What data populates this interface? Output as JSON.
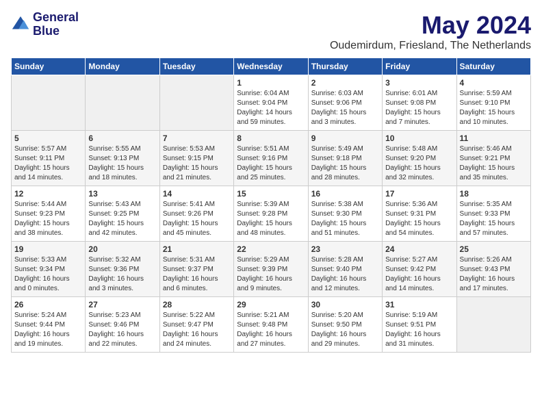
{
  "header": {
    "logo_line1": "General",
    "logo_line2": "Blue",
    "month_title": "May 2024",
    "subtitle": "Oudemirdum, Friesland, The Netherlands"
  },
  "weekdays": [
    "Sunday",
    "Monday",
    "Tuesday",
    "Wednesday",
    "Thursday",
    "Friday",
    "Saturday"
  ],
  "weeks": [
    [
      {
        "day": "",
        "content": ""
      },
      {
        "day": "",
        "content": ""
      },
      {
        "day": "",
        "content": ""
      },
      {
        "day": "1",
        "content": "Sunrise: 6:04 AM\nSunset: 9:04 PM\nDaylight: 14 hours\nand 59 minutes."
      },
      {
        "day": "2",
        "content": "Sunrise: 6:03 AM\nSunset: 9:06 PM\nDaylight: 15 hours\nand 3 minutes."
      },
      {
        "day": "3",
        "content": "Sunrise: 6:01 AM\nSunset: 9:08 PM\nDaylight: 15 hours\nand 7 minutes."
      },
      {
        "day": "4",
        "content": "Sunrise: 5:59 AM\nSunset: 9:10 PM\nDaylight: 15 hours\nand 10 minutes."
      }
    ],
    [
      {
        "day": "5",
        "content": "Sunrise: 5:57 AM\nSunset: 9:11 PM\nDaylight: 15 hours\nand 14 minutes."
      },
      {
        "day": "6",
        "content": "Sunrise: 5:55 AM\nSunset: 9:13 PM\nDaylight: 15 hours\nand 18 minutes."
      },
      {
        "day": "7",
        "content": "Sunrise: 5:53 AM\nSunset: 9:15 PM\nDaylight: 15 hours\nand 21 minutes."
      },
      {
        "day": "8",
        "content": "Sunrise: 5:51 AM\nSunset: 9:16 PM\nDaylight: 15 hours\nand 25 minutes."
      },
      {
        "day": "9",
        "content": "Sunrise: 5:49 AM\nSunset: 9:18 PM\nDaylight: 15 hours\nand 28 minutes."
      },
      {
        "day": "10",
        "content": "Sunrise: 5:48 AM\nSunset: 9:20 PM\nDaylight: 15 hours\nand 32 minutes."
      },
      {
        "day": "11",
        "content": "Sunrise: 5:46 AM\nSunset: 9:21 PM\nDaylight: 15 hours\nand 35 minutes."
      }
    ],
    [
      {
        "day": "12",
        "content": "Sunrise: 5:44 AM\nSunset: 9:23 PM\nDaylight: 15 hours\nand 38 minutes."
      },
      {
        "day": "13",
        "content": "Sunrise: 5:43 AM\nSunset: 9:25 PM\nDaylight: 15 hours\nand 42 minutes."
      },
      {
        "day": "14",
        "content": "Sunrise: 5:41 AM\nSunset: 9:26 PM\nDaylight: 15 hours\nand 45 minutes."
      },
      {
        "day": "15",
        "content": "Sunrise: 5:39 AM\nSunset: 9:28 PM\nDaylight: 15 hours\nand 48 minutes."
      },
      {
        "day": "16",
        "content": "Sunrise: 5:38 AM\nSunset: 9:30 PM\nDaylight: 15 hours\nand 51 minutes."
      },
      {
        "day": "17",
        "content": "Sunrise: 5:36 AM\nSunset: 9:31 PM\nDaylight: 15 hours\nand 54 minutes."
      },
      {
        "day": "18",
        "content": "Sunrise: 5:35 AM\nSunset: 9:33 PM\nDaylight: 15 hours\nand 57 minutes."
      }
    ],
    [
      {
        "day": "19",
        "content": "Sunrise: 5:33 AM\nSunset: 9:34 PM\nDaylight: 16 hours\nand 0 minutes."
      },
      {
        "day": "20",
        "content": "Sunrise: 5:32 AM\nSunset: 9:36 PM\nDaylight: 16 hours\nand 3 minutes."
      },
      {
        "day": "21",
        "content": "Sunrise: 5:31 AM\nSunset: 9:37 PM\nDaylight: 16 hours\nand 6 minutes."
      },
      {
        "day": "22",
        "content": "Sunrise: 5:29 AM\nSunset: 9:39 PM\nDaylight: 16 hours\nand 9 minutes."
      },
      {
        "day": "23",
        "content": "Sunrise: 5:28 AM\nSunset: 9:40 PM\nDaylight: 16 hours\nand 12 minutes."
      },
      {
        "day": "24",
        "content": "Sunrise: 5:27 AM\nSunset: 9:42 PM\nDaylight: 16 hours\nand 14 minutes."
      },
      {
        "day": "25",
        "content": "Sunrise: 5:26 AM\nSunset: 9:43 PM\nDaylight: 16 hours\nand 17 minutes."
      }
    ],
    [
      {
        "day": "26",
        "content": "Sunrise: 5:24 AM\nSunset: 9:44 PM\nDaylight: 16 hours\nand 19 minutes."
      },
      {
        "day": "27",
        "content": "Sunrise: 5:23 AM\nSunset: 9:46 PM\nDaylight: 16 hours\nand 22 minutes."
      },
      {
        "day": "28",
        "content": "Sunrise: 5:22 AM\nSunset: 9:47 PM\nDaylight: 16 hours\nand 24 minutes."
      },
      {
        "day": "29",
        "content": "Sunrise: 5:21 AM\nSunset: 9:48 PM\nDaylight: 16 hours\nand 27 minutes."
      },
      {
        "day": "30",
        "content": "Sunrise: 5:20 AM\nSunset: 9:50 PM\nDaylight: 16 hours\nand 29 minutes."
      },
      {
        "day": "31",
        "content": "Sunrise: 5:19 AM\nSunset: 9:51 PM\nDaylight: 16 hours\nand 31 minutes."
      },
      {
        "day": "",
        "content": ""
      }
    ]
  ]
}
